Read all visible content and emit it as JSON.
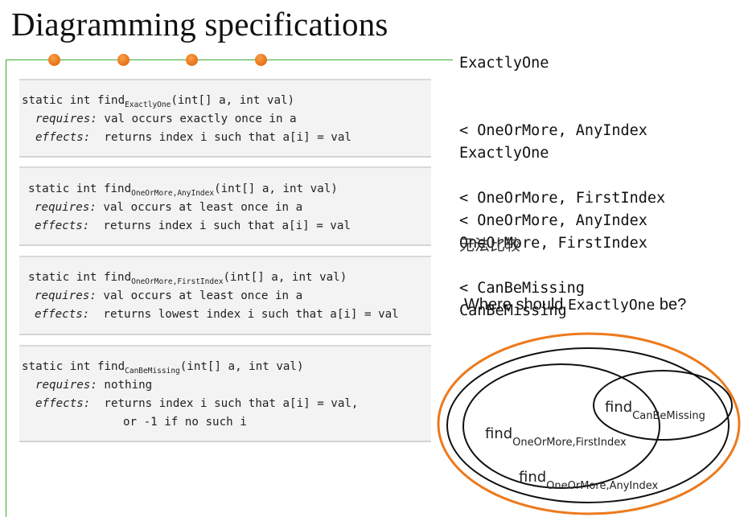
{
  "slide": {
    "title": "Diagramming specifications",
    "accent_color": "#ec7a1c",
    "rule_color": "#3aaa35"
  },
  "specs": [
    {
      "signature_prefix": "static int find",
      "subscript": "ExactlyOne",
      "signature_suffix": "(int[] a, int val)",
      "requires_label": "requires:",
      "requires": " val occurs exactly once in a",
      "effects_label": "effects:",
      "effects": "  returns index i such that a[i] = val",
      "effects_cont": ""
    },
    {
      "signature_prefix": "static int find",
      "subscript": "OneOrMore,AnyIndex",
      "signature_suffix": "(int[] a, int val)",
      "requires_label": "requires:",
      "requires": " val occurs at least once in a",
      "effects_label": "effects:",
      "effects": "  returns index i such that a[i] = val",
      "effects_cont": ""
    },
    {
      "signature_prefix": "static int find",
      "subscript": "OneOrMore,FirstIndex",
      "signature_suffix": "(int[] a, int val)",
      "requires_label": "requires:",
      "requires": " val occurs at least once in a",
      "effects_label": "effects:",
      "effects": "  returns lowest index i such that a[i] = val",
      "effects_cont": ""
    },
    {
      "signature_prefix": "static int find",
      "subscript": "CanBeMissing",
      "signature_suffix": "(int[] a, int val)",
      "requires_label": "requires:",
      "requires": " nothing",
      "effects_label": "effects:",
      "effects": "  returns index i such that a[i] = val,",
      "effects_cont": "or -1 if no such i"
    }
  ],
  "comparisons": [
    [
      "ExactlyOne",
      "< OneOrMore, AnyIndex",
      "< OneOrMore, FirstIndex"
    ],
    [
      "ExactlyOne",
      "< OneOrMore, AnyIndex",
      "< CanBeMissing"
    ],
    [
      "OneOrMore, FirstIndex",
      "CanBeMissing"
    ]
  ],
  "incomparable_note": "无法比较",
  "question": {
    "prefix": "Where should ",
    "code": "ExactlyOne",
    "suffix": " be?"
  },
  "venn": {
    "outer_color": "#ec7a1c",
    "inner_color": "#111111",
    "labels": [
      {
        "main": "find",
        "sub": "CanBeMissing"
      },
      {
        "main": "find",
        "sub": "OneOrMore,FirstIndex"
      },
      {
        "main": "find",
        "sub": "OneOrMore,AnyIndex"
      }
    ]
  }
}
